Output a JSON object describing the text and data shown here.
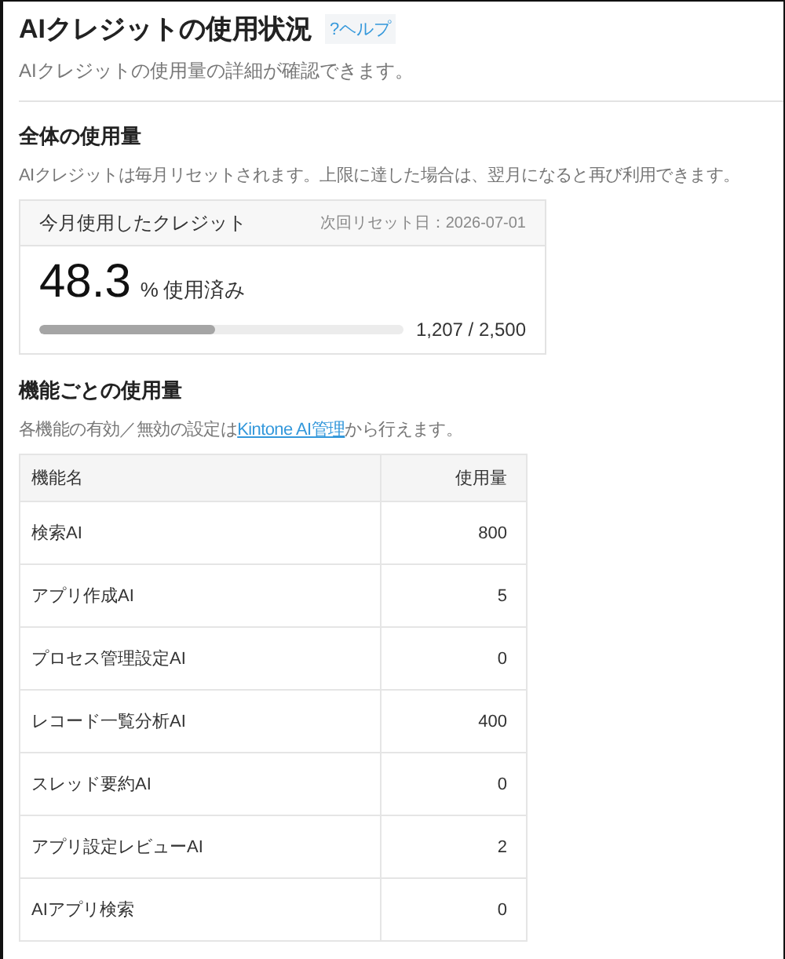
{
  "header": {
    "title": "AIクレジットの使用状況",
    "help_link": "?ヘルプ",
    "subtitle": "AIクレジットの使用量の詳細が確認できます。"
  },
  "overall": {
    "heading": "全体の使用量",
    "description": "AIクレジットは毎月リセットされます。上限に達した場合は、翌月になると再び利用できます。",
    "card": {
      "title": "今月使用したクレジット",
      "next_reset": "次回リセット日：2026-07-01",
      "percent": "48.3",
      "unit": "%",
      "used_label": "使用済み",
      "level": 0.483,
      "reading": "1,207 / 2,500"
    }
  },
  "by_feature": {
    "heading": "機能ごとの使用量",
    "description_before": "各機能の有効／無効の設定は",
    "link": "Kintone AI管理",
    "description_after": "から行えます。",
    "table": {
      "columns": [
        "機能名",
        "使用量"
      ],
      "rows": [
        {
          "name": "検索AI",
          "usage": "800"
        },
        {
          "name": "アプリ作成AI",
          "usage": "5"
        },
        {
          "name": "プロセス管理設定AI",
          "usage": "0"
        },
        {
          "name": "レコード一覧分析AI",
          "usage": "400"
        },
        {
          "name": "スレッド要約AI",
          "usage": "0"
        },
        {
          "name": "アプリ設定レビューAI",
          "usage": "2"
        },
        {
          "name": "AIアプリ検索",
          "usage": "0"
        }
      ]
    }
  }
}
